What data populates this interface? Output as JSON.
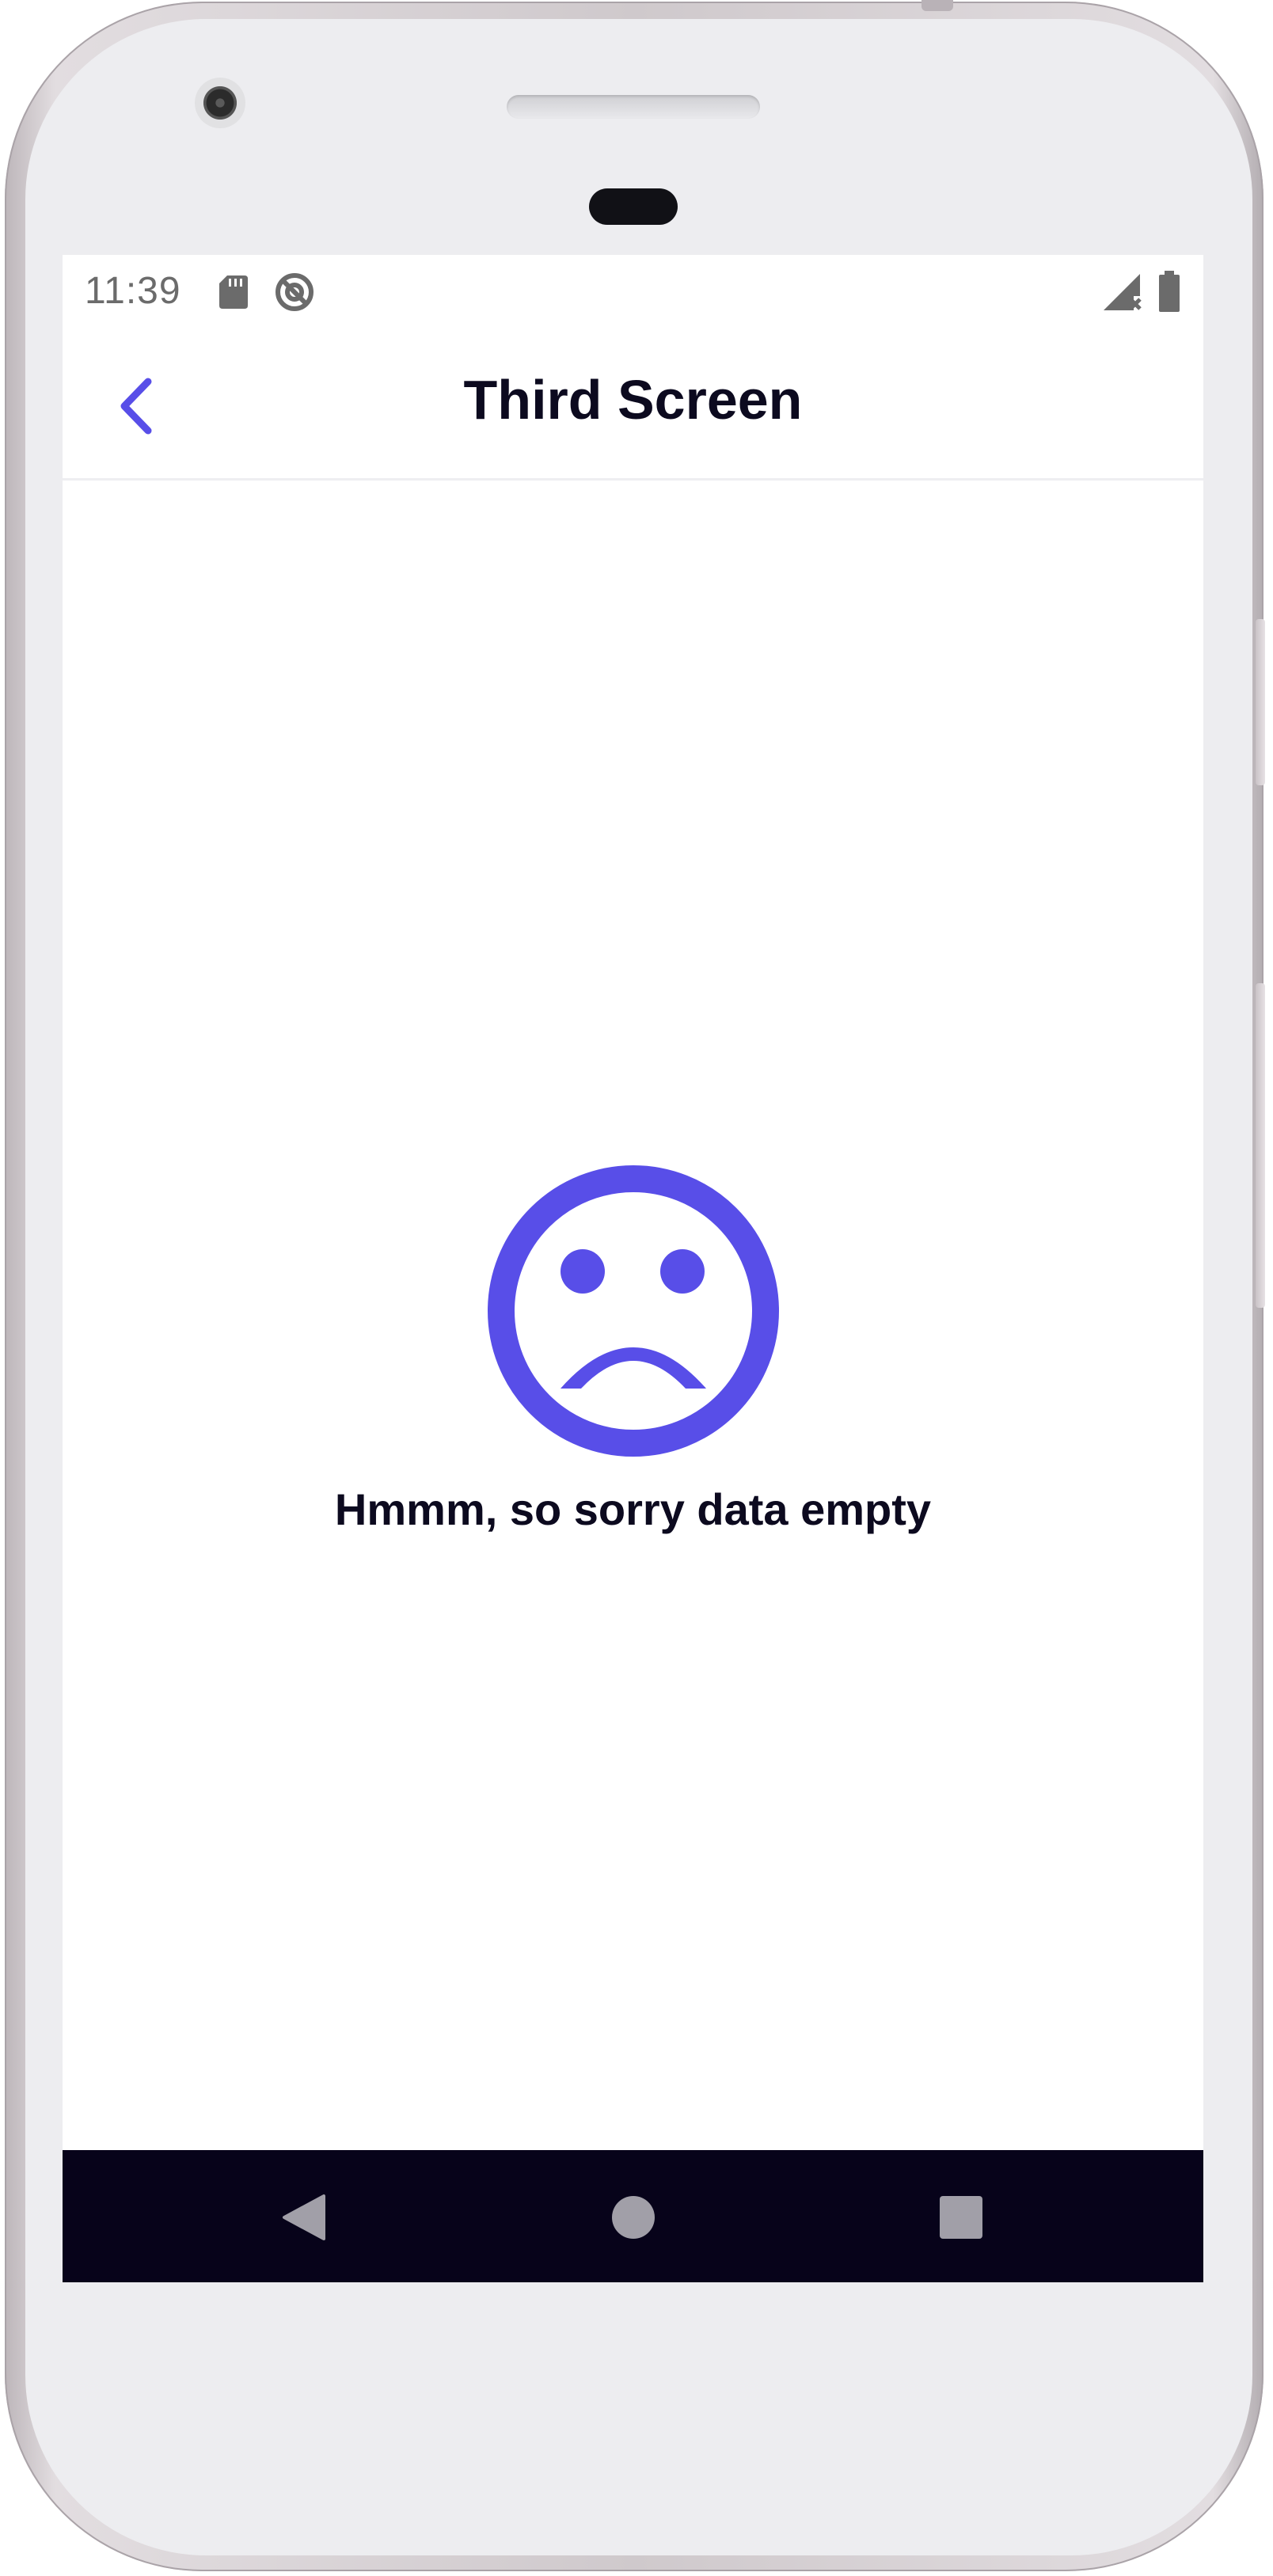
{
  "status_bar": {
    "time": "11:39",
    "icons": [
      "sd-card-icon",
      "data-saver-icon",
      "signal-no-service-icon",
      "battery-icon"
    ]
  },
  "app_bar": {
    "title": "Third Screen",
    "back_icon": "chevron-left-icon"
  },
  "empty_state": {
    "icon": "sad-face-icon",
    "message": "Hmmm, so sorry data empty"
  },
  "nav_bar": {
    "buttons": [
      "back-triangle-icon",
      "home-circle-icon",
      "recents-square-icon"
    ]
  },
  "colors": {
    "accent": "#584ee8",
    "title_text": "#0c0a1f",
    "nav_background": "#07031a",
    "nav_icons": "#a19fa8",
    "status_text": "#6b6b6b",
    "screen_background": "#ffffff"
  }
}
